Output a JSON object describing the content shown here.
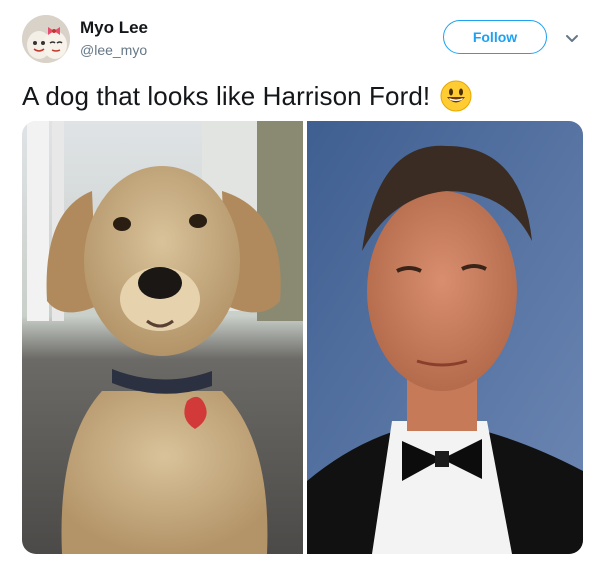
{
  "tweet": {
    "author_name": "Myo Lee",
    "author_handle": "@lee_myo",
    "follow_label": "Follow",
    "text": "A dog that looks like Harrison Ford!",
    "emoji": "grinning-face-icon"
  },
  "colors": {
    "accent": "#1da1f2",
    "text": "#14171a",
    "secondary": "#657786"
  },
  "media": {
    "count": 2,
    "photos": [
      "golden-retriever-puppy-photo",
      "man-in-tuxedo-photo"
    ]
  }
}
